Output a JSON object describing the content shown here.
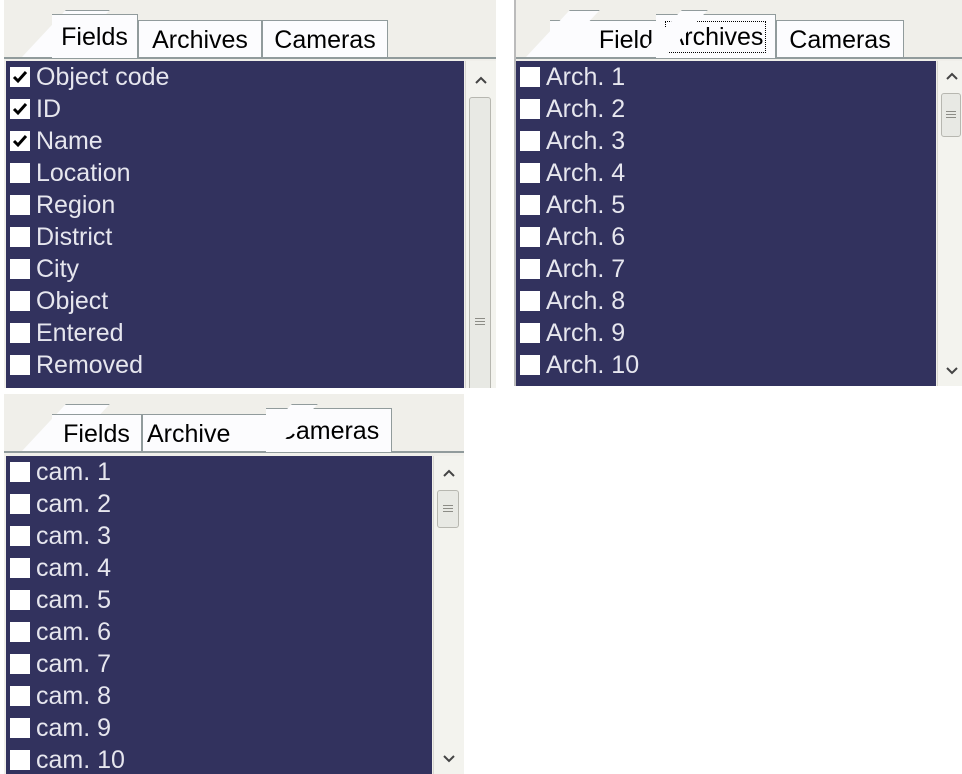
{
  "tabs": [
    "Fields",
    "Archives",
    "Cameras"
  ],
  "truncated_tabs": {
    "fields": "Field",
    "archives": "Archive"
  },
  "panel_fields": {
    "active_tab": "Fields",
    "items": [
      {
        "label": "Object code",
        "checked": true
      },
      {
        "label": "ID",
        "checked": true
      },
      {
        "label": "Name",
        "checked": true
      },
      {
        "label": "Location",
        "checked": false
      },
      {
        "label": "Region",
        "checked": false
      },
      {
        "label": "District",
        "checked": false
      },
      {
        "label": "City",
        "checked": false
      },
      {
        "label": "Object",
        "checked": false
      },
      {
        "label": "Entered",
        "checked": false
      },
      {
        "label": "Removed",
        "checked": false
      }
    ]
  },
  "panel_archives": {
    "active_tab": "Archives",
    "items": [
      {
        "label": "Arch. 1",
        "checked": false
      },
      {
        "label": "Arch. 2",
        "checked": false
      },
      {
        "label": "Arch. 3",
        "checked": false
      },
      {
        "label": "Arch. 4",
        "checked": false
      },
      {
        "label": "Arch. 5",
        "checked": false
      },
      {
        "label": "Arch. 6",
        "checked": false
      },
      {
        "label": "Arch. 7",
        "checked": false
      },
      {
        "label": "Arch. 8",
        "checked": false
      },
      {
        "label": "Arch. 9",
        "checked": false
      },
      {
        "label": "Arch. 10",
        "checked": false
      }
    ]
  },
  "panel_cameras": {
    "active_tab": "Cameras",
    "items": [
      {
        "label": "cam. 1",
        "checked": false
      },
      {
        "label": "cam. 2",
        "checked": false
      },
      {
        "label": "cam. 3",
        "checked": false
      },
      {
        "label": "cam. 4",
        "checked": false
      },
      {
        "label": "cam. 5",
        "checked": false
      },
      {
        "label": "cam. 6",
        "checked": false
      },
      {
        "label": "cam. 7",
        "checked": false
      },
      {
        "label": "cam. 8",
        "checked": false
      },
      {
        "label": "cam. 9",
        "checked": false
      },
      {
        "label": "cam. 10",
        "checked": false
      }
    ]
  },
  "colors": {
    "list_background": "#32325e",
    "item_text": "#e6e6ee",
    "panel_background": "#f0efea",
    "tab_background": "#fcfcfe"
  },
  "icons": {
    "checkbox": "check-icon",
    "scroll_up": "arrow-up-icon",
    "scroll_down": "arrow-down-icon",
    "scroll_thumb": "scroll-grip-icon"
  }
}
